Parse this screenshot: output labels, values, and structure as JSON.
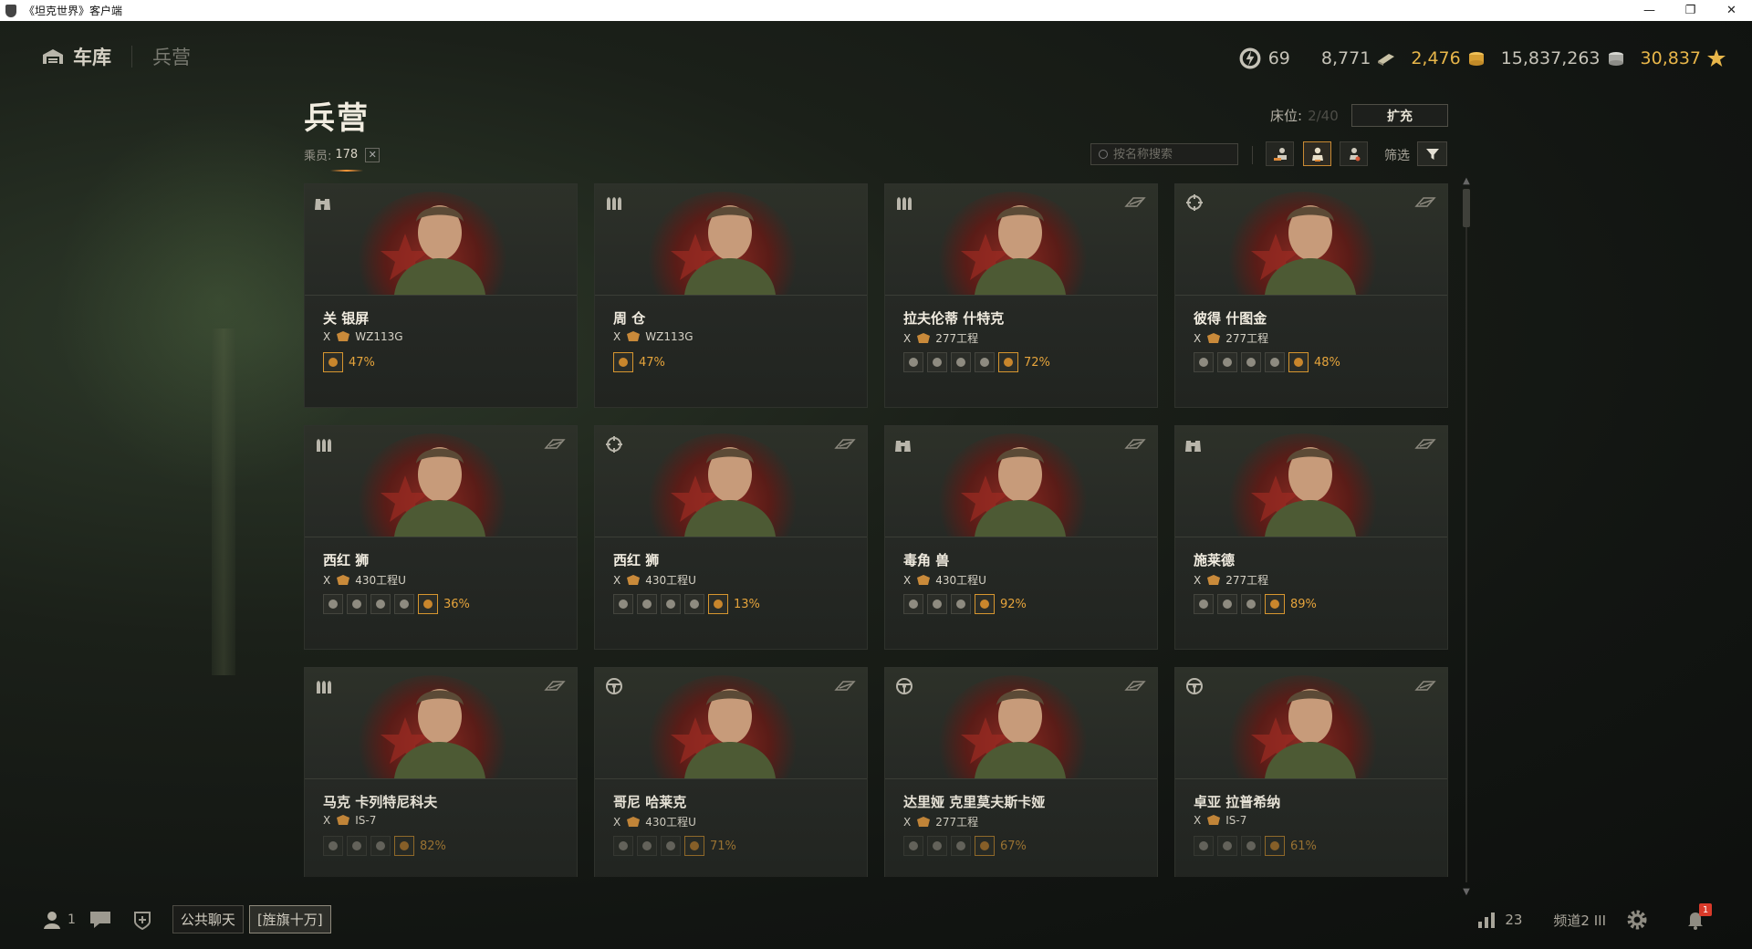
{
  "window": {
    "title": "《坦克世界》客户端",
    "controls": [
      "—",
      "❐",
      "✕"
    ]
  },
  "nav": {
    "garage": "车库",
    "barracks": "兵营"
  },
  "currency": {
    "free_xp": "69",
    "credits_xp": "8,771",
    "gold": "2,476",
    "credits": "15,837,263",
    "bonds": "30,837"
  },
  "header": {
    "title": "兵营",
    "crew_label": "乘员:",
    "crew_count": "178",
    "beds_label": "床位:",
    "beds_value": "2/40",
    "expand_label": "扩充",
    "search_placeholder": "按名称搜索",
    "filter_label": "筛选"
  },
  "cards": [
    {
      "name": "关 银屏",
      "tier": "X",
      "tank": "WZ113G",
      "role": "binoculars-icon",
      "pct": "47%",
      "skills": 1
    },
    {
      "name": "周 仓",
      "tier": "X",
      "tank": "WZ113G",
      "role": "shells-icon",
      "pct": "47%",
      "skills": 1
    },
    {
      "name": "拉夫伦蒂 什特克",
      "tier": "X",
      "tank": "277工程",
      "role": "shells-icon",
      "pct": "72%",
      "skills": 5
    },
    {
      "name": "彼得 什图金",
      "tier": "X",
      "tank": "277工程",
      "role": "crosshair-icon",
      "pct": "48%",
      "skills": 5
    },
    {
      "name": "西红 狮",
      "tier": "X",
      "tank": "430工程U",
      "role": "shells-icon",
      "pct": "36%",
      "skills": 5
    },
    {
      "name": "西红 狮",
      "tier": "X",
      "tank": "430工程U",
      "role": "crosshair-icon",
      "pct": "13%",
      "skills": 5
    },
    {
      "name": "毒角 兽",
      "tier": "X",
      "tank": "430工程U",
      "role": "binoculars-icon",
      "pct": "92%",
      "skills": 4
    },
    {
      "name": "施莱德",
      "tier": "X",
      "tank": "277工程",
      "role": "binoculars-icon",
      "pct": "89%",
      "skills": 4
    },
    {
      "name": "马克 卡列特尼科夫",
      "tier": "X",
      "tank": "IS-7",
      "role": "shells-icon",
      "pct": "82%",
      "skills": 4
    },
    {
      "name": "哥尼 哈莱克",
      "tier": "X",
      "tank": "430工程U",
      "role": "steering-icon",
      "pct": "71%",
      "skills": 4
    },
    {
      "name": "达里娅 克里莫夫斯卡娅",
      "tier": "X",
      "tank": "277工程",
      "role": "steering-icon",
      "pct": "67%",
      "skills": 4
    },
    {
      "name": "卓亚 拉普希纳",
      "tier": "X",
      "tank": "IS-7",
      "role": "steering-icon",
      "pct": "61%",
      "skills": 4
    }
  ],
  "bottom": {
    "players": "1",
    "chat_public": "公共聊天",
    "chat_clan": "[旌旗十万]",
    "ping": "23",
    "channel": "频道2 III",
    "notifications": "1"
  },
  "colors": {
    "accent": "#e6a43c",
    "badge": "#d93a2a",
    "portrait_glow": "#8a2a22"
  }
}
